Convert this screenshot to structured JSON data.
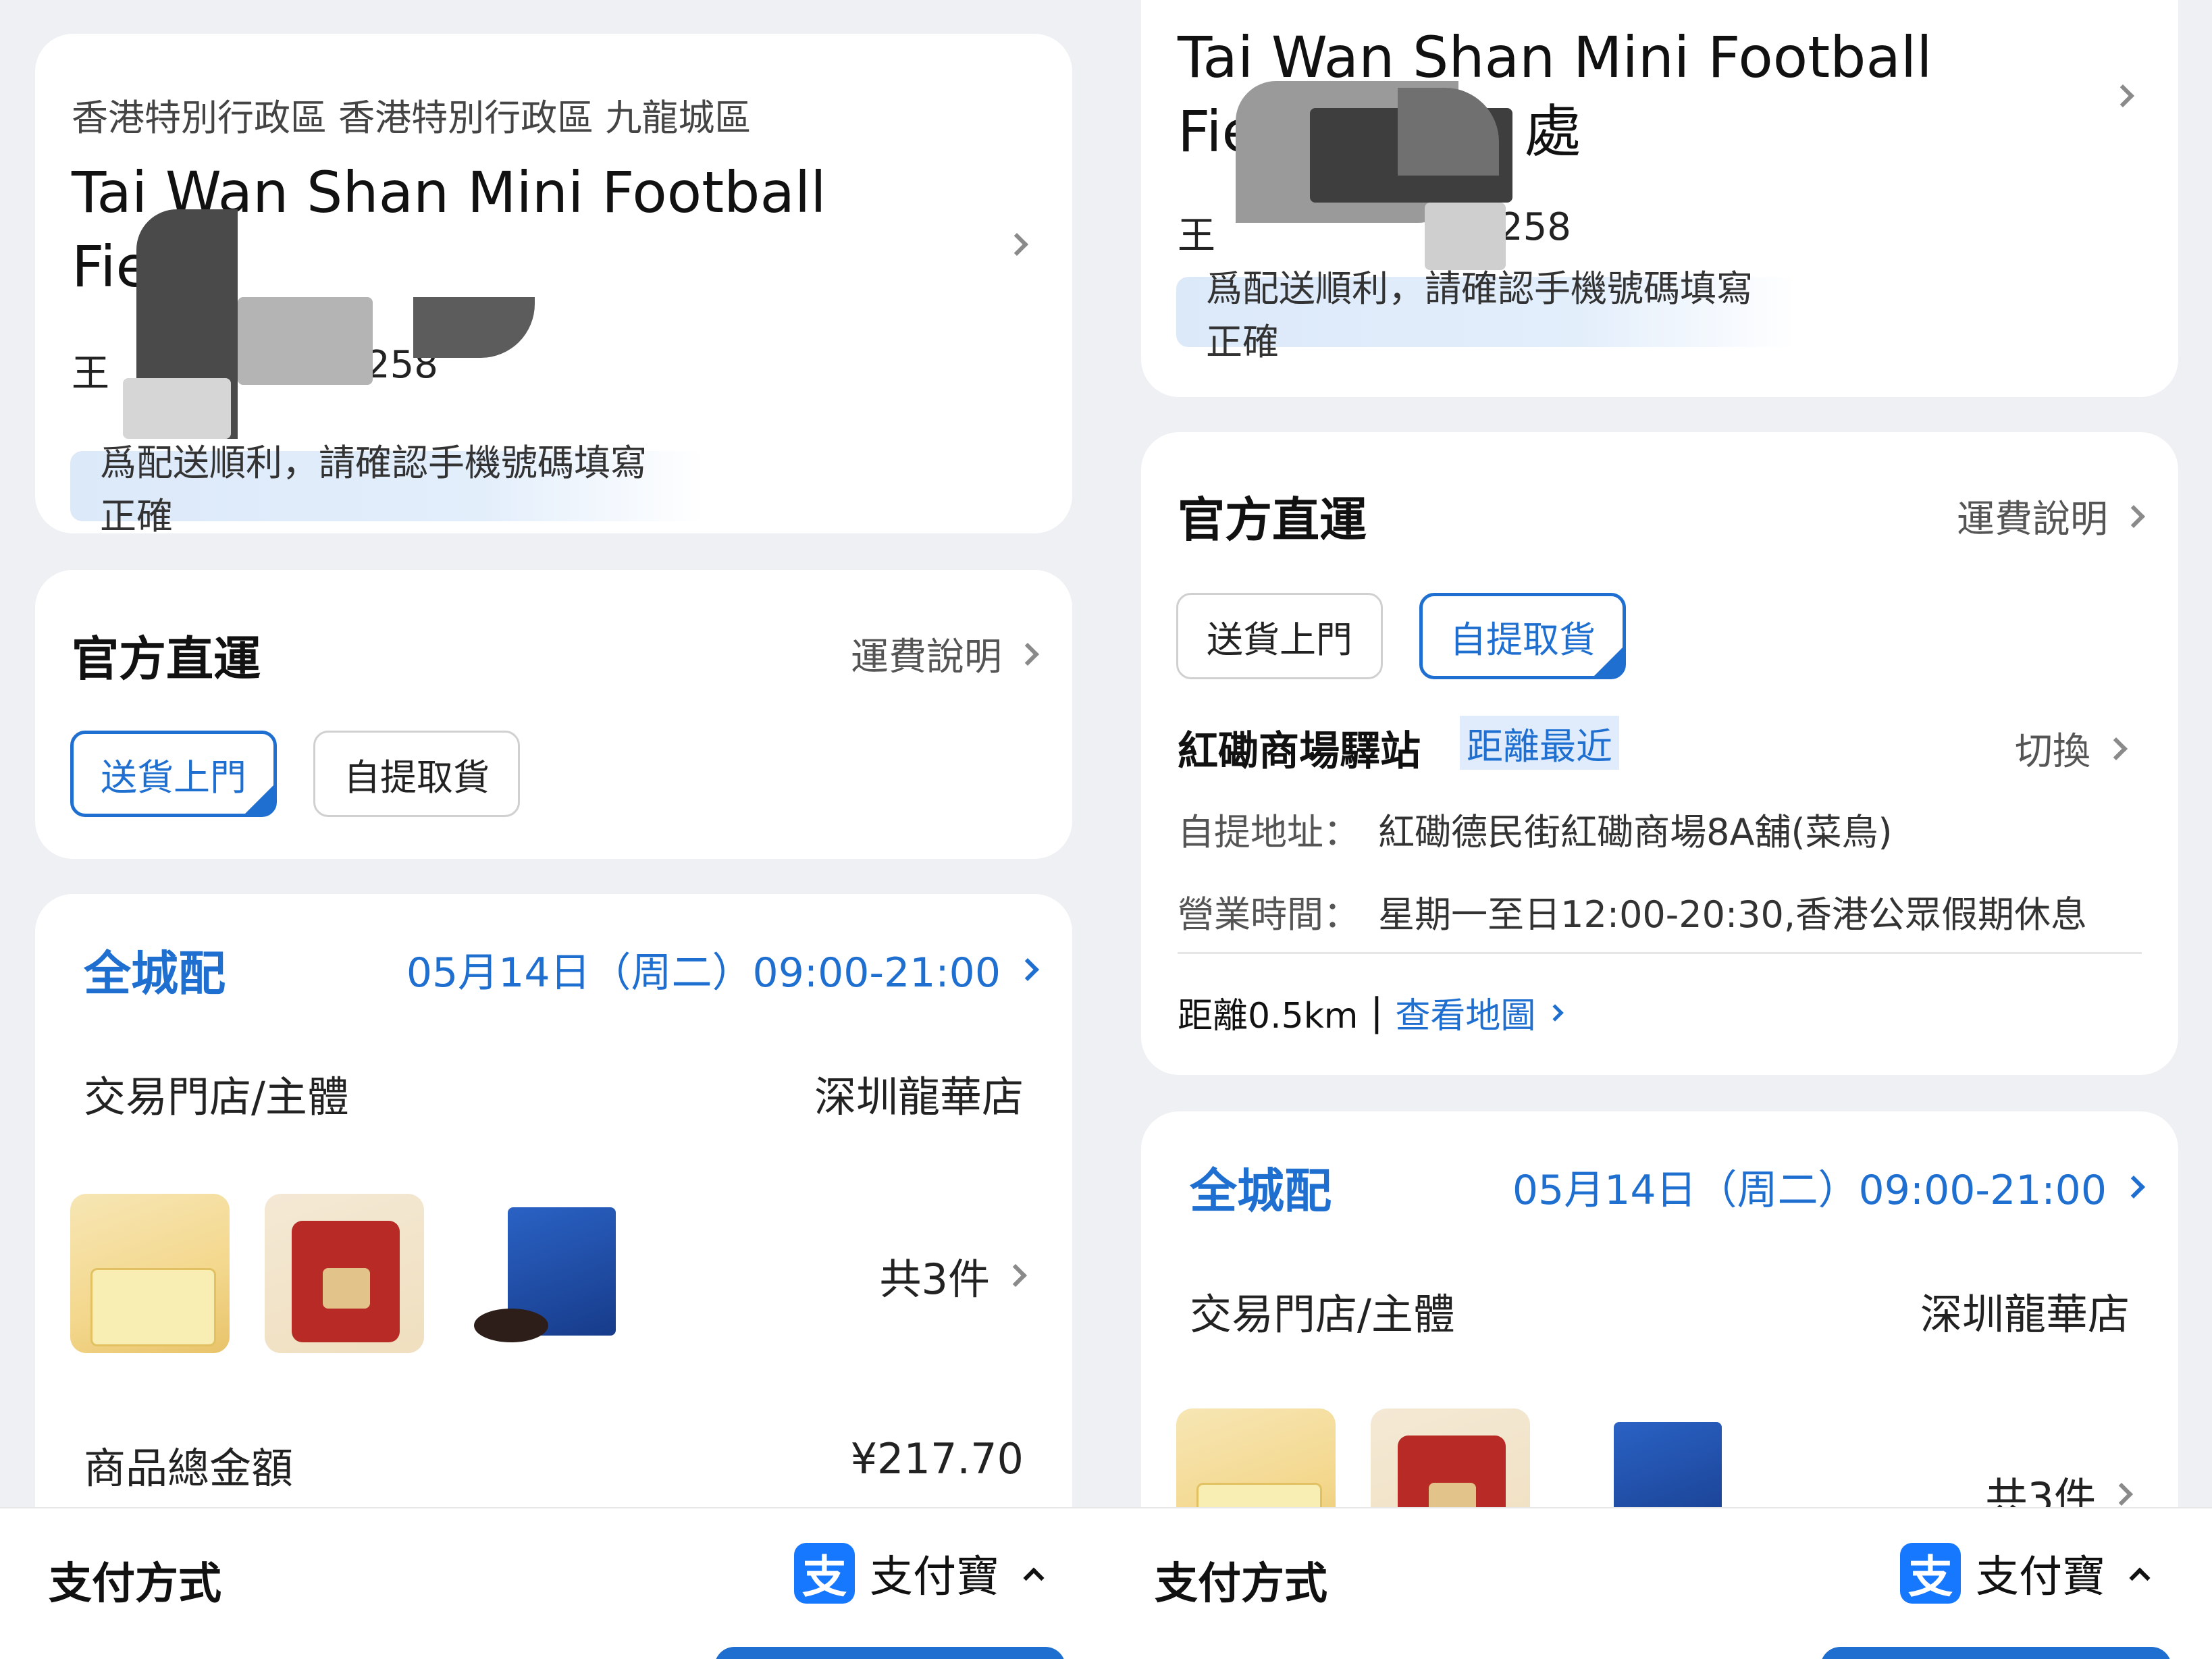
{
  "address": {
    "region": "香港特別行政區 香港特別行政區 九龍城區",
    "place_line1": "Tai Wan Shan Mini Football",
    "place_line2_left": "Fielc",
    "place_line2_right": "Fielc",
    "place_line2_right_tail": "處",
    "phone_prefix": "王",
    "phone_suffix_left": "258",
    "phone_suffix_right": "258",
    "notice": "爲配送順利，請確認手機號碼填寫正確"
  },
  "shipping": {
    "title": "官方直運",
    "fee_link": "運費說明",
    "option_home": "送貨上門",
    "option_pickup": "自提取貨",
    "pickup_station": "紅磡商場驛站",
    "pickup_badge": "距離最近",
    "switch_link": "切換",
    "pickup_address_label": "自提地址：",
    "pickup_address": "紅磡德民街紅磡商場8A舖(菜鳥)",
    "hours_label": "營業時間：",
    "hours": "星期一至日12:00-20:30,香港公眾假期休息",
    "distance": "距離0.5km",
    "separator": "|",
    "map_link": "查看地圖"
  },
  "delivery": {
    "mode": "全城配",
    "date": "05月14日（周二）09:00-21:00",
    "store_label": "交易門店/主體",
    "store_value": "深圳龍華店",
    "items_count": "共3件",
    "products": [
      "tissue-pack",
      "drip-coffee-bag",
      "oreo-box"
    ],
    "total_label": "商品總金額",
    "total_value": "¥217.70"
  },
  "payment": {
    "label": "支付方式",
    "method": "支付寶",
    "logo_glyph": "支"
  },
  "colors": {
    "accent": "#1f6fd1",
    "background": "#eef0f4",
    "card": "#ffffff",
    "notice_bg": "#dce9f9",
    "alipay": "#1677ff"
  }
}
